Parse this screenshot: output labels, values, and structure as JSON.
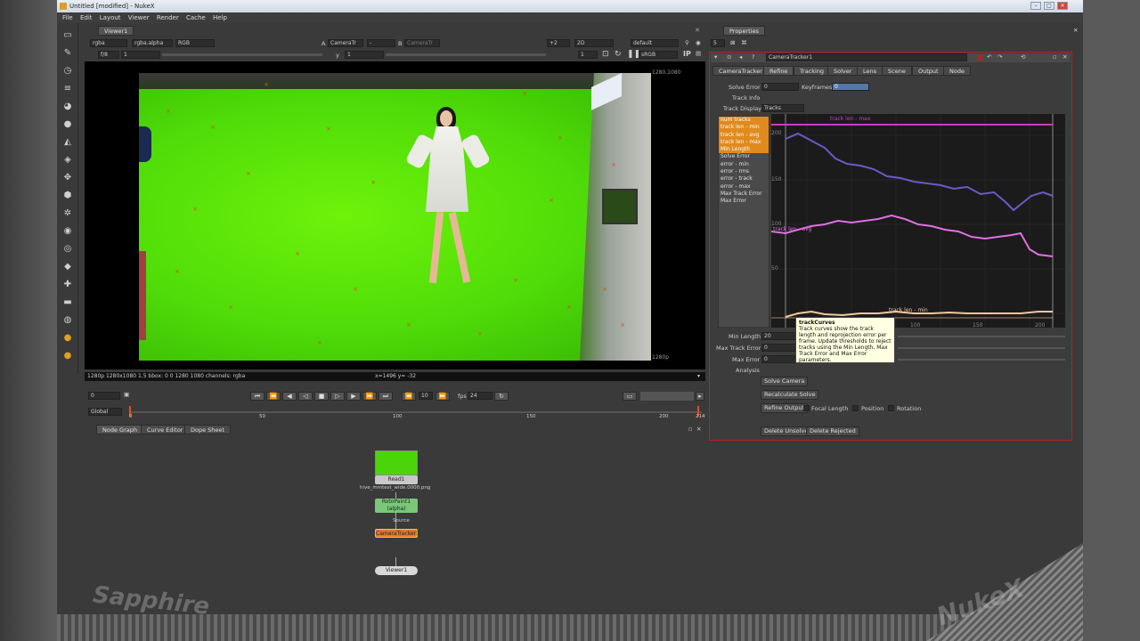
{
  "window": {
    "title": "Untitled [modified] - NukeX",
    "controls": [
      "–",
      "□",
      "✕"
    ]
  },
  "menu": [
    "File",
    "Edit",
    "Layout",
    "Viewer",
    "Render",
    "Cache",
    "Help"
  ],
  "left_toolbar_icons": [
    "image-icon",
    "paint-brush-icon",
    "clock-icon",
    "channel-icon",
    "color-icon",
    "circle-icon",
    "filter-icon",
    "layers-icon",
    "transform-icon",
    "3d-icon",
    "particles-icon",
    "deep-icon",
    "views-icon",
    "metadata-icon",
    "toolsets-icon",
    "other-icon",
    "ofx-icon",
    "furnace-icon"
  ],
  "viewer": {
    "tab": "Viewer1",
    "channels": "rgba",
    "alpha": "rgba.alpha",
    "colorspace_rgb": "RGB",
    "input_a_label": "A",
    "input_a": "CameraTr",
    "dash": "-",
    "input_b_label": "B",
    "input_b": "CameraTr",
    "gain": "+2",
    "view_mode": "2D",
    "lut": "default",
    "frame_left": "f/8",
    "frame_val": "1",
    "y_label": "y",
    "y_val": "1",
    "zoom_val": "1",
    "display_lut": "sRGB",
    "ip": "IP",
    "format_top_right": "1280,1080",
    "format_bottom_right": "1280p",
    "status": "1280p 1280x1080 1.5  bbox: 0 0 1280 1080 channels: rgba",
    "coords": "x=1496 y= -32"
  },
  "timeline": {
    "frame": "0",
    "fps_label": "fps",
    "fps": "24",
    "step": "10",
    "global": "Global",
    "ticks": [
      "0",
      "50",
      "100",
      "150",
      "200",
      "214"
    ]
  },
  "nodegraph": {
    "tabs": [
      "Node Graph",
      "Curve Editor",
      "Dope Sheet"
    ],
    "nodes": {
      "read": "Read1",
      "read_file": "hive_mmtest_wide.0000.png",
      "roto": "RotoPaint1",
      "roto_sub": "(alpha)",
      "source": "Source",
      "tracker": "CameraTracker1",
      "viewer": "Viewer1"
    }
  },
  "properties": {
    "title": "Properties",
    "count": "5",
    "node_name": "CameraTracker1",
    "tabs": [
      "CameraTracker",
      "Refine",
      "Tracking",
      "Solver",
      "Lens",
      "Scene",
      "Output",
      "Node"
    ],
    "solve_error_label": "Solve Error",
    "solve_error": "0",
    "keyframes_label": "Keyframes",
    "keyframes": "0",
    "track_info": "Track Info",
    "track_display_label": "Track Display",
    "track_display": "Tracks",
    "curve_list": [
      "num tracks",
      "track len - min",
      "track len - avg",
      "track len - max",
      "Min Length",
      "Solve Error",
      "error - min",
      "error - rms",
      "error - track",
      "error - max",
      "Max Track Error",
      "Max Error"
    ],
    "curve_selected": [
      0,
      1,
      2,
      3,
      4
    ],
    "plot_y_ticks": [
      "200",
      "150",
      "100",
      "50"
    ],
    "plot_x_ticks": [
      "100",
      "150",
      "200"
    ],
    "plot_labels": {
      "max": "track len - max",
      "avg": "track len - avg",
      "min": "track len - min"
    },
    "min_length_label": "Min Length",
    "min_length": "20",
    "max_track_error_label": "Max Track Error",
    "max_track_error": "0",
    "max_error_label": "Max Error",
    "max_error": "0",
    "analysis_label": "Analysis",
    "buttons": {
      "solve_camera": "Solve Camera",
      "recalculate_solve": "Recalculate Solve",
      "refine_output": "Refine Output",
      "delete_unsolved": "Delete Unsolved",
      "delete_rejected": "Delete Rejected"
    },
    "checkboxes": [
      "Focal Length",
      "Position",
      "Rotation"
    ],
    "tooltip_title": "trackCurves",
    "tooltip_body": "Track curves show the track length and reprojection error per frame. Update thresholds to reject tracks using the Min Length, Max Track Error and Max Error parameters.",
    "colors": {
      "border": "#b32222",
      "selected": "#e08a1e",
      "max_curve": "#c040c0",
      "avg_curve": "#e070e0",
      "min_curve": "#f0c8a0"
    }
  },
  "watermarks": {
    "left": "Sapphire",
    "right": "NukeX"
  }
}
